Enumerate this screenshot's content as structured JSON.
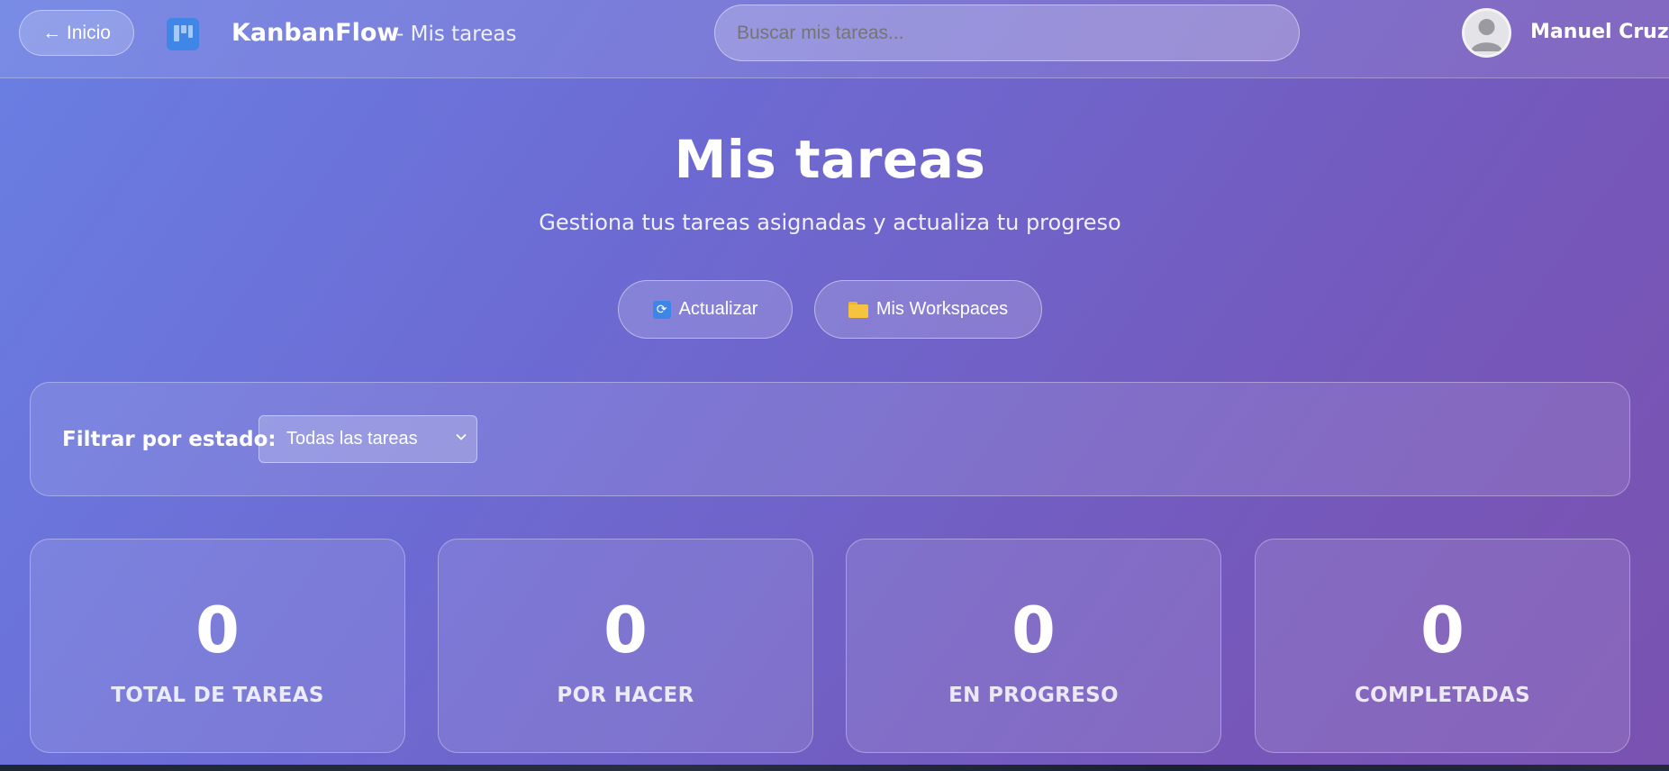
{
  "header": {
    "back_label": "← Inicio",
    "brand": "KanbanFlow",
    "brand_sub": "- Mis tareas",
    "search_placeholder": "Buscar mis tareas...",
    "user_name": "Manuel Cruz"
  },
  "hero": {
    "title": "Mis tareas",
    "subtitle": "Gestiona tus tareas asignadas y actualiza tu progreso"
  },
  "actions": {
    "refresh_label": "Actualizar",
    "workspaces_label": "Mis Workspaces"
  },
  "filter": {
    "label": "Filtrar por estado:",
    "selected": "Todas las tareas"
  },
  "stats": [
    {
      "value": "0",
      "label": "TOTAL DE TAREAS"
    },
    {
      "value": "0",
      "label": "POR HACER"
    },
    {
      "value": "0",
      "label": "EN PROGRESO"
    },
    {
      "value": "0",
      "label": "COMPLETADAS"
    }
  ],
  "icons": {
    "logo": "kanban-board-icon",
    "refresh": "refresh-icon",
    "folder": "folder-icon",
    "avatar": "user-avatar-icon",
    "dropdown": "chevron-down-icon"
  },
  "colors": {
    "gradient_start": "#6a7fe3",
    "gradient_end": "#7a52b0",
    "logo_blue": "#3f86e6",
    "folder_yellow": "#f6c33f"
  }
}
